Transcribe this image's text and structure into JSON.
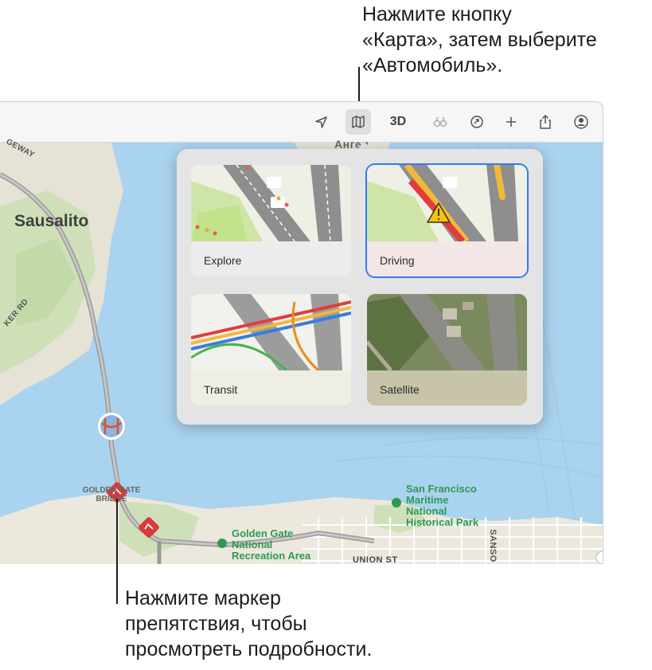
{
  "callouts": {
    "top": [
      "Нажмите кнопку",
      "«Карта», затем выберите",
      "«Автомобиль»."
    ],
    "bottom": [
      "Нажмите маркер",
      "препятствия, чтобы",
      "просмотреть подробности."
    ]
  },
  "toolbar": {
    "buttons": [
      {
        "name": "location-arrow-icon"
      },
      {
        "name": "map-mode-icon",
        "active": true
      },
      {
        "name": "3d-button",
        "label": "3D"
      },
      {
        "name": "look-around-icon"
      },
      {
        "name": "rotate-icon"
      },
      {
        "name": "add-icon"
      },
      {
        "name": "share-icon"
      },
      {
        "name": "account-icon"
      }
    ]
  },
  "map": {
    "labels": {
      "sausalito": "Sausalito",
      "road_top_left": "GEWAY",
      "road_left": "KER RD",
      "top_partial": "Ангел",
      "golden_gate_bridge": "GOLDEN GATE\nBRIDGE",
      "sf_maritime": "San Francisco\nMaritime\nNational\nHistorical Park",
      "gg_recreation": "Golden Gate\nNational\nRecreation Area",
      "union_st": "UNION ST",
      "sansome": "SANSO"
    },
    "colors": {
      "water": "#a9d3ee",
      "land": "#e8e4da",
      "park": "#cfe2b7",
      "highway": "#9a9a9a",
      "incident": "#d93b3b"
    }
  },
  "map_modes": {
    "selected": "Driving",
    "cards": [
      {
        "label": "Explore"
      },
      {
        "label": "Driving"
      },
      {
        "label": "Transit"
      },
      {
        "label": "Satellite"
      }
    ]
  }
}
